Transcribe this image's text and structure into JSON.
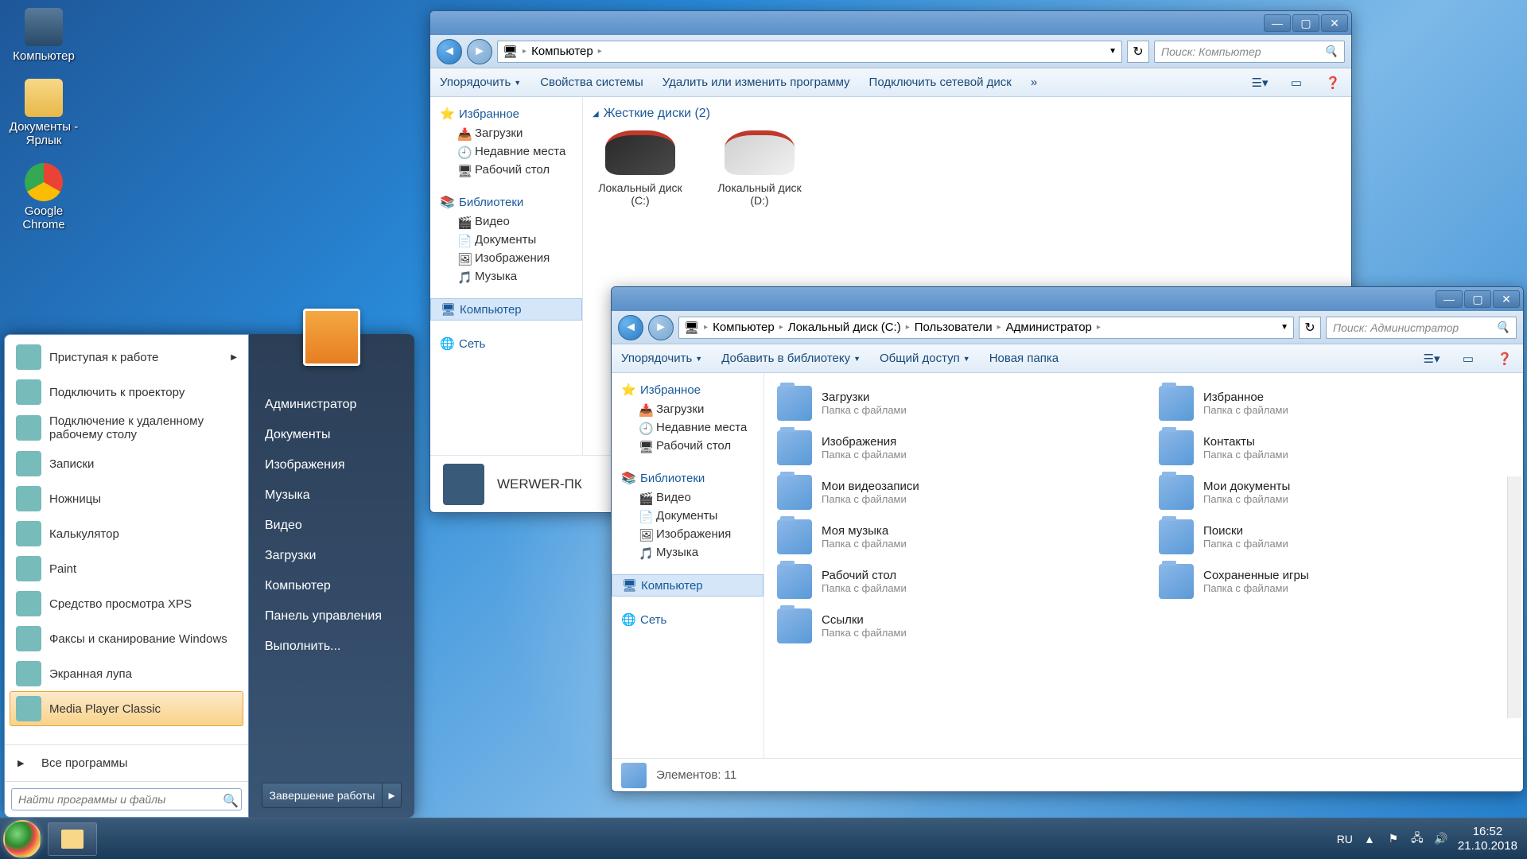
{
  "desktop_icons": [
    {
      "label": "Компьютер"
    },
    {
      "label": "Документы - Ярлык"
    },
    {
      "label": "Google Chrome"
    }
  ],
  "start_menu": {
    "programs": [
      {
        "label": "Приступая к работе",
        "has_arrow": true
      },
      {
        "label": "Подключить к проектору"
      },
      {
        "label": "Подключение к удаленному рабочему столу"
      },
      {
        "label": "Записки"
      },
      {
        "label": "Ножницы"
      },
      {
        "label": "Калькулятор"
      },
      {
        "label": "Paint"
      },
      {
        "label": "Средство просмотра XPS"
      },
      {
        "label": "Факсы и сканирование Windows"
      },
      {
        "label": "Экранная лупа"
      },
      {
        "label": "Media Player Classic",
        "highlighted": true
      }
    ],
    "all_programs": "Все программы",
    "search_placeholder": "Найти программы и файлы",
    "right": [
      "Администратор",
      "Документы",
      "Изображения",
      "Музыка",
      "Видео",
      "Загрузки",
      "Компьютер",
      "Панель управления",
      "Выполнить..."
    ],
    "shutdown": "Завершение работы"
  },
  "explorer1": {
    "breadcrumb": [
      "Компьютер"
    ],
    "search_placeholder": "Поиск: Компьютер",
    "toolbar": [
      "Упорядочить",
      "Свойства системы",
      "Удалить или изменить программу",
      "Подключить сетевой диск"
    ],
    "sidebar": {
      "favorites": {
        "header": "Избранное",
        "items": [
          "Загрузки",
          "Недавние места",
          "Рабочий стол"
        ]
      },
      "libraries": {
        "header": "Библиотеки",
        "items": [
          "Видео",
          "Документы",
          "Изображения",
          "Музыка"
        ]
      },
      "computer": "Компьютер",
      "network": "Сеть"
    },
    "content": {
      "section": "Жесткие диски (2)",
      "drives": [
        {
          "name": "Локальный диск (C:)"
        },
        {
          "name": "Локальный диск (D:)"
        }
      ]
    },
    "details": {
      "title": "WERWER-ПК"
    }
  },
  "explorer2": {
    "breadcrumb": [
      "Компьютер",
      "Локальный диск (C:)",
      "Пользователи",
      "Администратор"
    ],
    "search_placeholder": "Поиск: Администратор",
    "toolbar": [
      "Упорядочить",
      "Добавить в библиотеку",
      "Общий доступ",
      "Новая папка"
    ],
    "sidebar": {
      "favorites": {
        "header": "Избранное",
        "items": [
          "Загрузки",
          "Недавние места",
          "Рабочий стол"
        ]
      },
      "libraries": {
        "header": "Библиотеки",
        "items": [
          "Видео",
          "Документы",
          "Изображения",
          "Музыка"
        ]
      },
      "computer": "Компьютер",
      "network": "Сеть"
    },
    "folders": [
      {
        "name": "Загрузки",
        "type": "Папка с файлами"
      },
      {
        "name": "Избранное",
        "type": "Папка с файлами"
      },
      {
        "name": "Изображения",
        "type": "Папка с файлами"
      },
      {
        "name": "Контакты",
        "type": "Папка с файлами"
      },
      {
        "name": "Мои видеозаписи",
        "type": "Папка с файлами"
      },
      {
        "name": "Мои документы",
        "type": "Папка с файлами"
      },
      {
        "name": "Моя музыка",
        "type": "Папка с файлами"
      },
      {
        "name": "Поиски",
        "type": "Папка с файлами"
      },
      {
        "name": "Рабочий стол",
        "type": "Папка с файлами"
      },
      {
        "name": "Сохраненные игры",
        "type": "Папка с файлами"
      },
      {
        "name": "Ссылки",
        "type": "Папка с файлами"
      }
    ],
    "status": "Элементов: 11"
  },
  "taskbar": {
    "lang": "RU",
    "time": "16:52",
    "date": "21.10.2018"
  }
}
